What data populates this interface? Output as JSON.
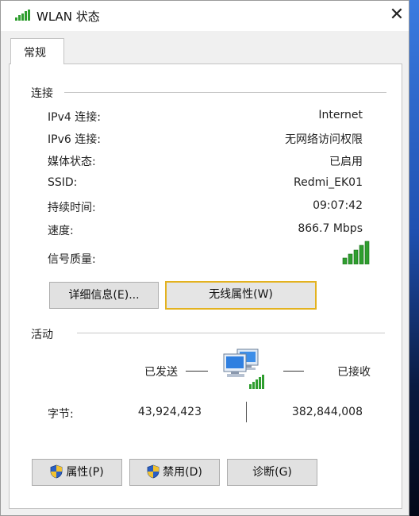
{
  "window": {
    "title": "WLAN 状态",
    "close_glyph": "✕",
    "title_icon": "wifi-signal-icon"
  },
  "tabs": [
    {
      "label": "常规",
      "selected": true
    }
  ],
  "connection": {
    "group_label": "连接",
    "rows": [
      {
        "label": "IPv4 连接:",
        "value": "Internet"
      },
      {
        "label": "IPv6 连接:",
        "value": "无网络访问权限"
      },
      {
        "label": "媒体状态:",
        "value": "已启用"
      },
      {
        "label": "SSID:",
        "value": "Redmi_EK01"
      },
      {
        "label": "持续时间:",
        "value": "09:07:42"
      },
      {
        "label": "速度:",
        "value": "866.7 Mbps"
      }
    ],
    "signal_label": "信号质量:",
    "signal_bars": 5,
    "signal_max": 5,
    "details_button": "详细信息(E)...",
    "wireless_props_button": "无线属性(W)"
  },
  "activity": {
    "group_label": "活动",
    "sent_label": "已发送",
    "received_label": "已接收",
    "bytes_label": "字节:",
    "bytes_sent": "43,924,423",
    "bytes_received": "382,844,008",
    "network_icon": "network-computers-icon"
  },
  "footer": {
    "properties_button": "属性(P)",
    "disable_button": "禁用(D)",
    "diagnose_button": "诊断(G)"
  },
  "colors": {
    "signal_green": "#2f9e2f",
    "focus_border": "#e3b21f",
    "shield_blue": "#2a5fc4",
    "shield_yellow": "#f2c230"
  }
}
